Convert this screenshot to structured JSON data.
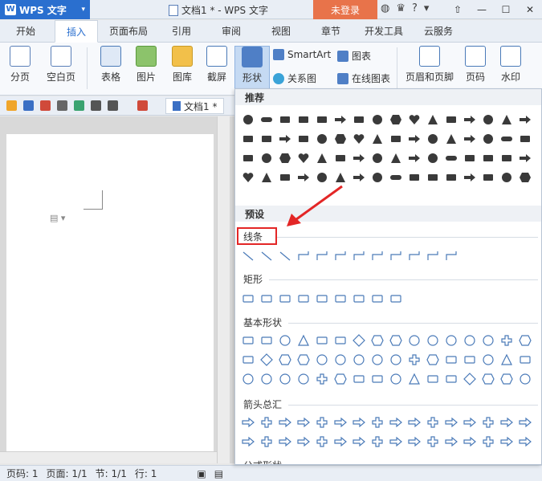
{
  "app": {
    "logo_text": "WPS 文字",
    "doc_title": "文档1 * - WPS 文字",
    "login_label": "未登录"
  },
  "tabs": [
    "开始",
    "插入",
    "页面布局",
    "引用",
    "审阅",
    "视图",
    "章节",
    "开发工具",
    "云服务"
  ],
  "active_tab": "插入",
  "ribbon": {
    "page_break": "分页",
    "blank_page": "空白页",
    "table": "表格",
    "picture": "图片",
    "gallery": "图库",
    "screenshot": "截屏",
    "shapes": "形状",
    "smartart": "SmartArt",
    "chart": "图表",
    "relation": "关系图",
    "online_chart": "在线图表",
    "header_footer": "页眉和页脚",
    "page_number": "页码",
    "watermark": "水印"
  },
  "quickbar": {
    "doc_tab": "文档1 *"
  },
  "statusbar": {
    "page_num": "页码: 1",
    "page_total": "页面: 1/1",
    "section": "节: 1/1",
    "line": "行: 1"
  },
  "panel": {
    "recommended": "推荐",
    "presets": "预设",
    "lines": "线条",
    "rectangles": "矩形",
    "basic_shapes": "基本形状",
    "block_arrows": "箭头总汇",
    "equation_shapes": "公式形状"
  },
  "colors": {
    "accent": "#2a6fcf",
    "login": "#e8734a",
    "highlight": "#e32626",
    "shape_fill": "#3a3a3a",
    "shape_outline": "#4a7ab8"
  },
  "icons": {
    "recommended_row1": [
      "circle",
      "rounded-rect",
      "pill",
      "rect-bar",
      "speech-bubble",
      "arrow-diag",
      "speech",
      "rect",
      "octagon",
      "heart",
      "lightning",
      "square-outline",
      "arrow-right",
      "balloon",
      "crowd",
      "arrow-up"
    ],
    "recommended_row2": [
      "triangle",
      "people",
      "globe",
      "phone",
      "heart-outline",
      "rect",
      "ring",
      "mountain",
      "ribbon",
      "rect",
      "person",
      "rect",
      "triangle",
      "parallelogram",
      "rect",
      "trapezoid"
    ],
    "recommended_row3": [
      "sun",
      "hexagon",
      "octagon",
      "money-bag",
      "monitor",
      "triangle-up",
      "circle-dashed",
      "arrow-right",
      "plus",
      "diamond",
      "plus-thick",
      "location",
      "check",
      "people",
      "cross",
      "question"
    ],
    "recommended_row4": [
      "laptop",
      "corner",
      "cube",
      "card",
      "people",
      "arrow-right",
      "arrow-right",
      "rect",
      "chart-line",
      "rect",
      "rect",
      "person-add",
      "hand",
      "diamond-arrow",
      "money-bag",
      "up-arrow"
    ]
  }
}
